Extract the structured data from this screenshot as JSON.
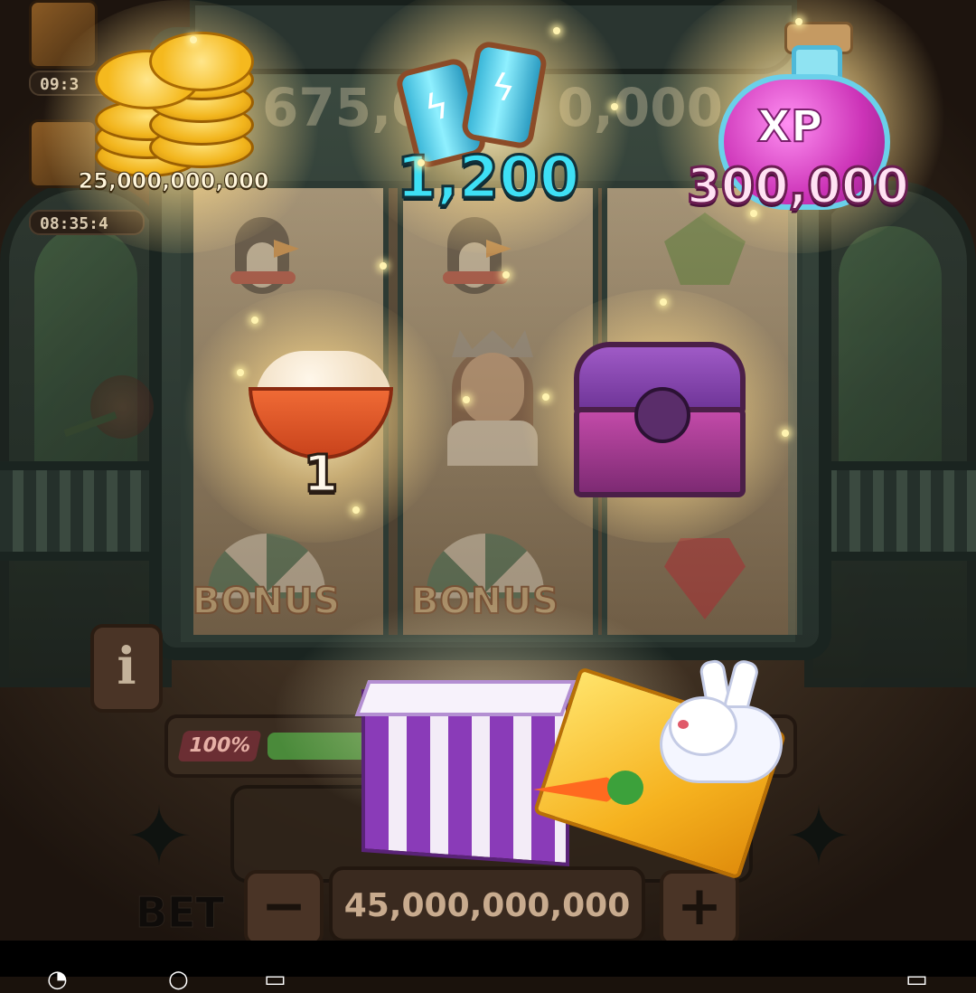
{
  "side_timers": [
    "09:3",
    "08:35:4"
  ],
  "reels_counter": {
    "left": "675,0",
    "right": "0,000"
  },
  "rewards": {
    "coins": {
      "label": "25,000,000,000",
      "icon": "coin-stack-icon"
    },
    "spins": {
      "label": "1,200",
      "icon": "energy-can-icon"
    },
    "xp": {
      "label": "300,000",
      "icon": "xp-potion-icon",
      "potion_text": "XP"
    },
    "cream": {
      "label": "1",
      "icon": "cream-bowl-icon"
    },
    "chest": {
      "icon": "treasure-chest-icon"
    }
  },
  "reel_symbols": {
    "bonus_1": "BONUS",
    "bonus_2": "BONUS"
  },
  "controls": {
    "info_label": "i",
    "progress_percent_label": "100%",
    "progress_fraction": 1.0,
    "bet_label": "BET",
    "bet_value": "45,000,000,000",
    "minus_label": "−",
    "plus_label": "+"
  },
  "colors": {
    "spins": "#3ee0f5",
    "xp": "#ffe2f3",
    "progress_fill": "#4a8a3a"
  }
}
